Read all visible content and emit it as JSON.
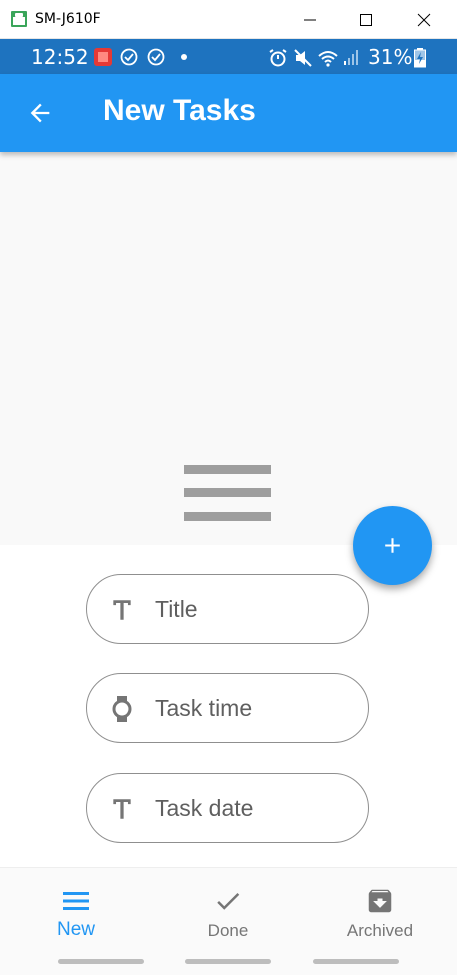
{
  "window": {
    "title": "SM-J610F"
  },
  "status_bar": {
    "time": "12:52",
    "battery": "31%"
  },
  "app_bar": {
    "title": "New Tasks"
  },
  "form": {
    "fields": [
      {
        "name": "title",
        "placeholder": "Title",
        "icon": "text-t-icon"
      },
      {
        "name": "task-time",
        "placeholder": "Task time",
        "icon": "watch-icon"
      },
      {
        "name": "task-date",
        "placeholder": "Task date",
        "icon": "text-t-icon"
      }
    ]
  },
  "bottom_nav": {
    "items": [
      {
        "label": "New",
        "icon": "menu-icon",
        "active": true
      },
      {
        "label": "Done",
        "icon": "check-icon",
        "active": false
      },
      {
        "label": "Archived",
        "icon": "archive-icon",
        "active": false
      }
    ]
  },
  "colors": {
    "primary": "#2196f3",
    "status_bar": "#1e73bf",
    "inactive": "#767676",
    "field_border": "#8f8f8f"
  }
}
